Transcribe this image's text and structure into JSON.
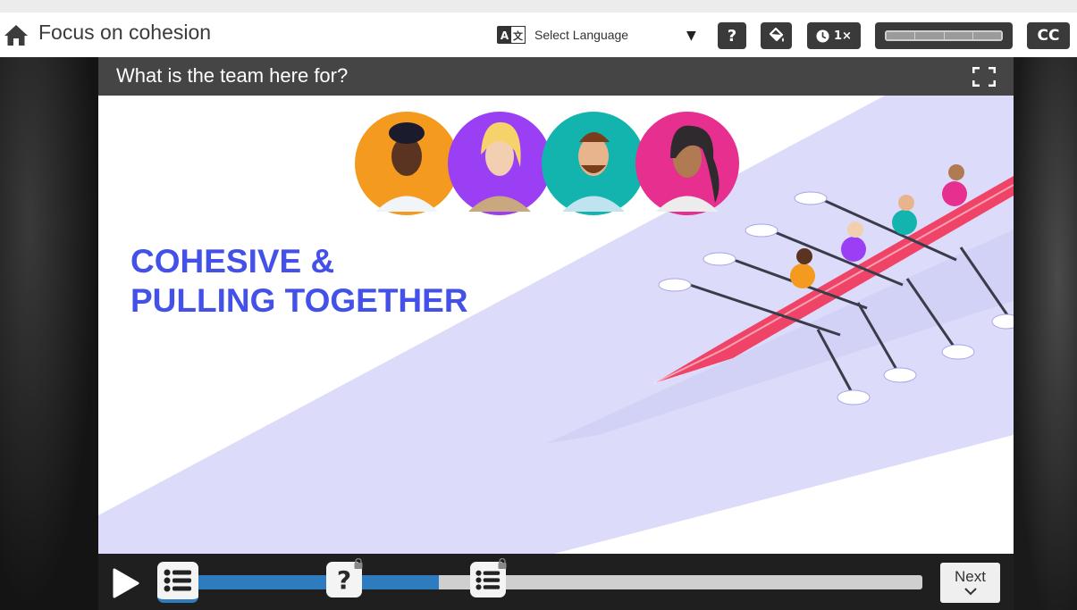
{
  "header": {
    "course_title": "Focus on cohesion",
    "language_label": "Select Language",
    "help_label": "?",
    "speed_label": "1×",
    "cc_label": "CC",
    "progress_segments": 4
  },
  "slide": {
    "title": "What is the team here for?",
    "headline_line1": "COHESIVE &",
    "headline_line2": "PULLING TOGETHER",
    "accent_color": "#4451e8",
    "water_color": "#dcdcfa",
    "avatar_colors": [
      "#f39a1f",
      "#9b3ff5",
      "#13b4ad",
      "#e62f8f"
    ]
  },
  "player": {
    "progress": 0.35,
    "next_label": "Next",
    "progress_color": "#2f7bbf",
    "markers": [
      {
        "type": "list",
        "state": "current",
        "icon": "list-icon"
      },
      {
        "type": "question",
        "state": "locked",
        "icon": "question-icon"
      },
      {
        "type": "list",
        "state": "locked",
        "icon": "list-icon"
      }
    ]
  }
}
